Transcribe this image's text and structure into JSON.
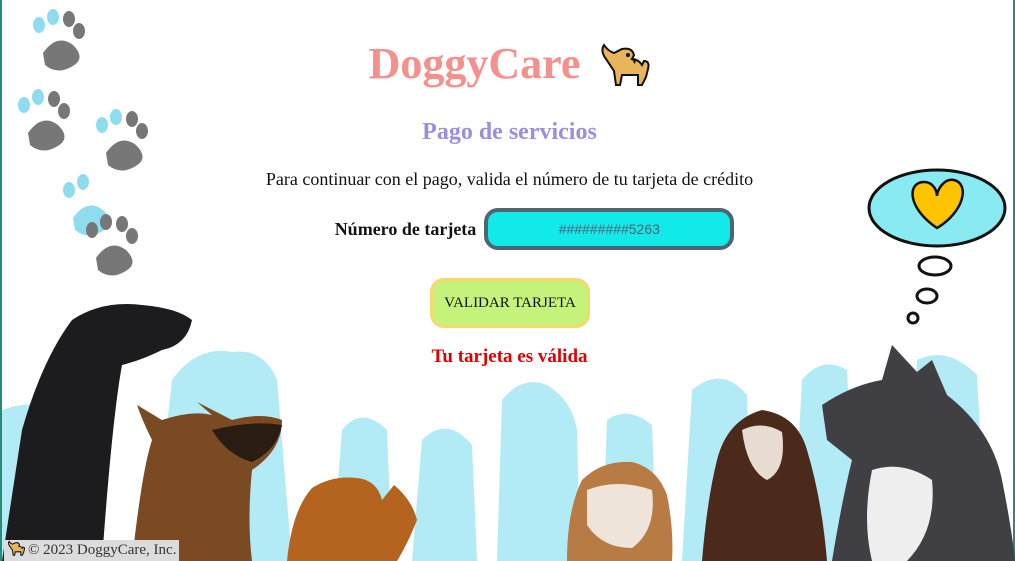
{
  "header": {
    "title": "DoggyCare",
    "title_icon": "dog-emoji"
  },
  "main": {
    "subtitle": "Pago de servicios",
    "instruction": "Para continuar con el pago, valida el número de tu tarjeta de crédito",
    "card_label": "Número de tarjeta",
    "card_value": "#########5263",
    "validate_label": "VALIDAR TARJETA",
    "result_text": "Tu tarjeta es válida"
  },
  "footer": {
    "text": "© 2023 DoggyCare, Inc.",
    "icon": "dog-emoji"
  },
  "decor": {
    "paw_icons": 5,
    "thought_bubble_icon": "heart",
    "colors": {
      "title": "#f4918c",
      "subtitle": "#9a8ee0",
      "input_bg": "#12e9e9",
      "button_bg": "#c5f27a",
      "result": "#e00000",
      "splash": "#b2ebf5"
    }
  }
}
